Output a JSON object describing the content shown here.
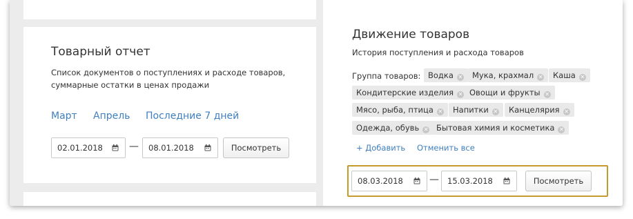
{
  "report": {
    "title": "Товарный отчет",
    "description": "Список документов о поступлениях и расходе товаров, суммарные остатки в ценах продажи",
    "periods": [
      "Март",
      "Апрель",
      "Последние 7 дней"
    ],
    "date_from": "02.01.2018",
    "date_to": "08.01.2018",
    "view_button": "Посмотреть"
  },
  "movement": {
    "title": "Движение товаров",
    "description": "История поступления и расхода товаров",
    "group_label": "Группа товаров:",
    "tags": [
      "Водка",
      "Мука, крахмал",
      "Каша",
      "Кондитерские изделия",
      "Овощи и фрукты",
      "Мясо, рыба, птица",
      "Напитки",
      "Канцелярия",
      "Одежда, обувь",
      "Бытовая химия и косметика"
    ],
    "add_label": "+ Добавить",
    "cancel_all_label": "Отменить все",
    "date_from": "08.03.2018",
    "date_to": "15.03.2018",
    "view_button": "Посмотреть"
  },
  "separator": "—",
  "colors": {
    "link": "#3f7fbf",
    "focus_outline": "#c49a2c",
    "tag_background": "#e9e9e9",
    "window_background": "#ececec"
  },
  "icons": {
    "date_picker": "calendar-icon",
    "tag_remove": "remove-tag-icon"
  }
}
